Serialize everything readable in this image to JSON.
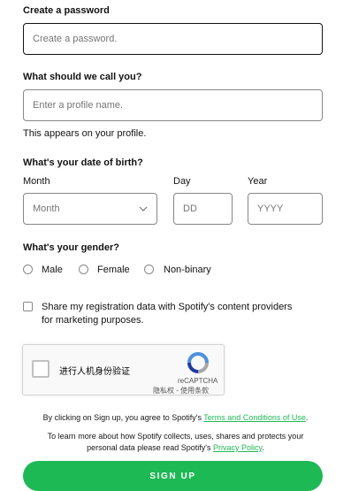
{
  "password": {
    "label": "Create a password",
    "placeholder": "Create a password."
  },
  "profile": {
    "label": "What should we call you?",
    "placeholder": "Enter a profile name.",
    "hint": "This appears on your profile."
  },
  "dob": {
    "label": "What's your date of birth?",
    "month_label": "Month",
    "month_placeholder": "Month",
    "day_label": "Day",
    "day_placeholder": "DD",
    "year_label": "Year",
    "year_placeholder": "YYYY"
  },
  "gender": {
    "label": "What's your gender?",
    "options": [
      "Male",
      "Female",
      "Non-binary"
    ]
  },
  "marketing": {
    "line1": "Share my registration data with Spotify's content providers",
    "line2": "for marketing purposes."
  },
  "captcha": {
    "text": "进行人机身份验证",
    "brand": "reCAPTCHA",
    "privacy": "隐私权",
    "separator": " - ",
    "terms": "使用条款"
  },
  "legal": {
    "line1_prefix": "By clicking on Sign up, you agree to Spotify's ",
    "line1_link": "Terms and Conditions of Use",
    "line1_suffix": ".",
    "line2": "To learn more about how Spotify collects, uses, shares and protects your",
    "line3_prefix": "personal data please read Spotify's ",
    "line3_link": "Privacy Policy",
    "line3_suffix": "."
  },
  "signup_label": "SIGN UP",
  "colors": {
    "accent": "#1db954",
    "text": "#121212",
    "border": "#878787"
  }
}
